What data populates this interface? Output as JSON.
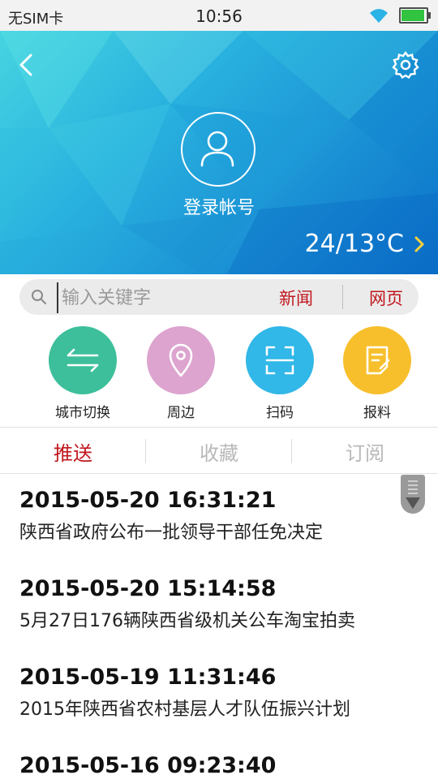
{
  "status": {
    "carrier": "无SIM卡",
    "time": "10:56",
    "battery_level": 0.95,
    "battery_color": "#32c341"
  },
  "header": {
    "back_icon": "chevron-left-icon",
    "settings_icon": "gear-icon",
    "avatar_icon": "user-icon",
    "login_label": "登录帐号",
    "weather": "24/13°C"
  },
  "search": {
    "placeholder": "输入关键字",
    "value": "",
    "news_button": "新闻",
    "web_button": "网页"
  },
  "shortcuts": [
    {
      "label": "城市切换",
      "icon": "swap-arrows-icon",
      "color": "#3dbf9b"
    },
    {
      "label": "周边",
      "icon": "location-pin-icon",
      "color": "#dca4cf"
    },
    {
      "label": "扫码",
      "icon": "scan-icon",
      "color": "#31b7e8"
    },
    {
      "label": "报料",
      "icon": "note-edit-icon",
      "color": "#f7bf2c"
    }
  ],
  "tabs": [
    {
      "label": "推送",
      "active": true
    },
    {
      "label": "收藏",
      "active": false
    },
    {
      "label": "订阅",
      "active": false
    }
  ],
  "feed": [
    {
      "time": "2015-05-20 16:31:21",
      "title": "陕西省政府公布一批领导干部任免决定"
    },
    {
      "time": "2015-05-20 15:14:58",
      "title": "5月27日176辆陕西省级机关公车淘宝拍卖"
    },
    {
      "time": "2015-05-19 11:31:46",
      "title": "2015年陕西省农村基层人才队伍振兴计划"
    },
    {
      "time": "2015-05-16 09:23:40",
      "title": ""
    }
  ],
  "colors": {
    "accent": "#c0171e",
    "header_gradient": [
      "#46d4e0",
      "#0b6fc8"
    ]
  }
}
